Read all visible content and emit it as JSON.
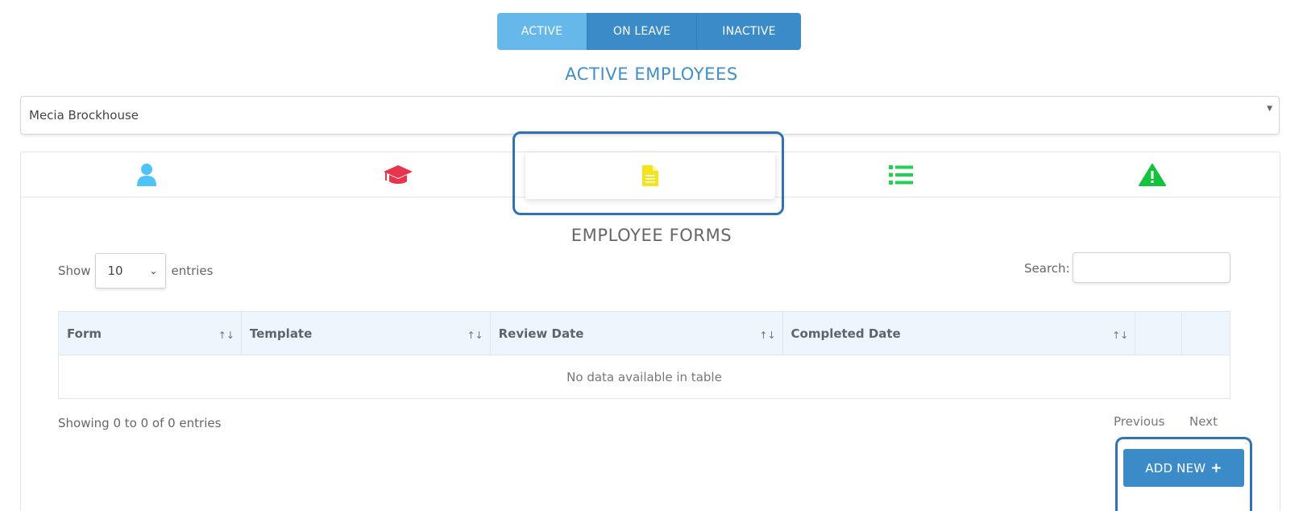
{
  "status_tabs": [
    {
      "label": "ACTIVE",
      "selected": true
    },
    {
      "label": "ON LEAVE",
      "selected": false
    },
    {
      "label": "INACTIVE",
      "selected": false
    }
  ],
  "active_title": "ACTIVE EMPLOYEES",
  "employee_select": {
    "value": "Mecia Brockhouse"
  },
  "icon_tabs": [
    {
      "icon": "user-icon",
      "color": "#4fc3f7"
    },
    {
      "icon": "graduation-cap-icon",
      "color": "#e8344e"
    },
    {
      "icon": "document-icon",
      "color": "#f5e31b",
      "selected": true
    },
    {
      "icon": "list-icon",
      "color": "#1fd14f"
    },
    {
      "icon": "warning-icon",
      "color": "#12c43c"
    }
  ],
  "forms_title": "EMPLOYEE FORMS",
  "length_control": {
    "show": "Show",
    "value": "10",
    "entries": "entries"
  },
  "search": {
    "label": "Search:",
    "value": ""
  },
  "table": {
    "columns": [
      "Form",
      "Template",
      "Review Date",
      "Completed Date",
      "",
      ""
    ],
    "empty_message": "No data available in table"
  },
  "info": "Showing 0 to 0 of 0 entries",
  "pagination": {
    "previous": "Previous",
    "next": "Next"
  },
  "add_button": {
    "label": "ADD NEW",
    "plus": "+"
  },
  "colors": {
    "primary": "#3a8bc8",
    "active_tab": "#66b8ea",
    "highlight": "#2f73b6"
  }
}
